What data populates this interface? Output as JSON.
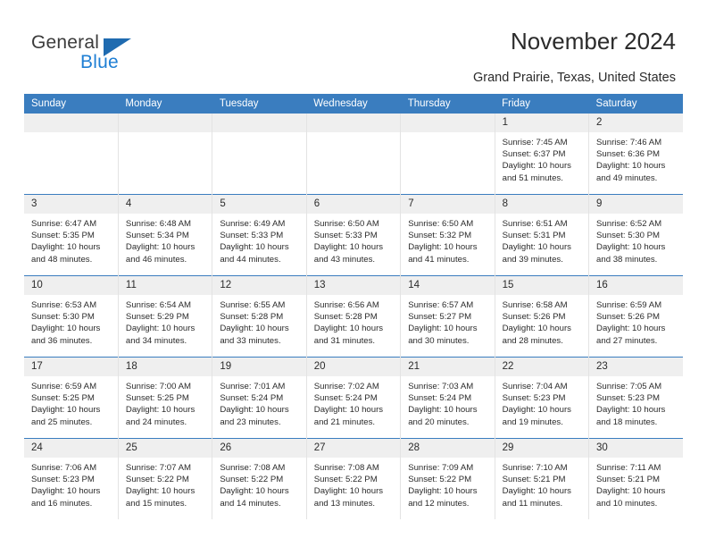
{
  "brand": {
    "name_top": "General",
    "name_bottom": "Blue",
    "triangle_color": "#1f6bb0",
    "blue_color": "#1f7fd4"
  },
  "header": {
    "title": "November 2024",
    "subtitle": "Grand Prairie, Texas, United States",
    "header_bg": "#3a7dbf",
    "daynum_bg": "#efefef"
  },
  "weekdays": [
    "Sunday",
    "Monday",
    "Tuesday",
    "Wednesday",
    "Thursday",
    "Friday",
    "Saturday"
  ],
  "labels": {
    "sunrise": "Sunrise:",
    "sunset": "Sunset:",
    "daylight": "Daylight:"
  },
  "weeks": [
    [
      {
        "day": "",
        "empty": true
      },
      {
        "day": "",
        "empty": true
      },
      {
        "day": "",
        "empty": true
      },
      {
        "day": "",
        "empty": true
      },
      {
        "day": "",
        "empty": true
      },
      {
        "day": "1",
        "sunrise": "Sunrise: 7:45 AM",
        "sunset": "Sunset: 6:37 PM",
        "daylight1": "Daylight: 10 hours",
        "daylight2": "and 51 minutes."
      },
      {
        "day": "2",
        "sunrise": "Sunrise: 7:46 AM",
        "sunset": "Sunset: 6:36 PM",
        "daylight1": "Daylight: 10 hours",
        "daylight2": "and 49 minutes."
      }
    ],
    [
      {
        "day": "3",
        "sunrise": "Sunrise: 6:47 AM",
        "sunset": "Sunset: 5:35 PM",
        "daylight1": "Daylight: 10 hours",
        "daylight2": "and 48 minutes."
      },
      {
        "day": "4",
        "sunrise": "Sunrise: 6:48 AM",
        "sunset": "Sunset: 5:34 PM",
        "daylight1": "Daylight: 10 hours",
        "daylight2": "and 46 minutes."
      },
      {
        "day": "5",
        "sunrise": "Sunrise: 6:49 AM",
        "sunset": "Sunset: 5:33 PM",
        "daylight1": "Daylight: 10 hours",
        "daylight2": "and 44 minutes."
      },
      {
        "day": "6",
        "sunrise": "Sunrise: 6:50 AM",
        "sunset": "Sunset: 5:33 PM",
        "daylight1": "Daylight: 10 hours",
        "daylight2": "and 43 minutes."
      },
      {
        "day": "7",
        "sunrise": "Sunrise: 6:50 AM",
        "sunset": "Sunset: 5:32 PM",
        "daylight1": "Daylight: 10 hours",
        "daylight2": "and 41 minutes."
      },
      {
        "day": "8",
        "sunrise": "Sunrise: 6:51 AM",
        "sunset": "Sunset: 5:31 PM",
        "daylight1": "Daylight: 10 hours",
        "daylight2": "and 39 minutes."
      },
      {
        "day": "9",
        "sunrise": "Sunrise: 6:52 AM",
        "sunset": "Sunset: 5:30 PM",
        "daylight1": "Daylight: 10 hours",
        "daylight2": "and 38 minutes."
      }
    ],
    [
      {
        "day": "10",
        "sunrise": "Sunrise: 6:53 AM",
        "sunset": "Sunset: 5:30 PM",
        "daylight1": "Daylight: 10 hours",
        "daylight2": "and 36 minutes."
      },
      {
        "day": "11",
        "sunrise": "Sunrise: 6:54 AM",
        "sunset": "Sunset: 5:29 PM",
        "daylight1": "Daylight: 10 hours",
        "daylight2": "and 34 minutes."
      },
      {
        "day": "12",
        "sunrise": "Sunrise: 6:55 AM",
        "sunset": "Sunset: 5:28 PM",
        "daylight1": "Daylight: 10 hours",
        "daylight2": "and 33 minutes."
      },
      {
        "day": "13",
        "sunrise": "Sunrise: 6:56 AM",
        "sunset": "Sunset: 5:28 PM",
        "daylight1": "Daylight: 10 hours",
        "daylight2": "and 31 minutes."
      },
      {
        "day": "14",
        "sunrise": "Sunrise: 6:57 AM",
        "sunset": "Sunset: 5:27 PM",
        "daylight1": "Daylight: 10 hours",
        "daylight2": "and 30 minutes."
      },
      {
        "day": "15",
        "sunrise": "Sunrise: 6:58 AM",
        "sunset": "Sunset: 5:26 PM",
        "daylight1": "Daylight: 10 hours",
        "daylight2": "and 28 minutes."
      },
      {
        "day": "16",
        "sunrise": "Sunrise: 6:59 AM",
        "sunset": "Sunset: 5:26 PM",
        "daylight1": "Daylight: 10 hours",
        "daylight2": "and 27 minutes."
      }
    ],
    [
      {
        "day": "17",
        "sunrise": "Sunrise: 6:59 AM",
        "sunset": "Sunset: 5:25 PM",
        "daylight1": "Daylight: 10 hours",
        "daylight2": "and 25 minutes."
      },
      {
        "day": "18",
        "sunrise": "Sunrise: 7:00 AM",
        "sunset": "Sunset: 5:25 PM",
        "daylight1": "Daylight: 10 hours",
        "daylight2": "and 24 minutes."
      },
      {
        "day": "19",
        "sunrise": "Sunrise: 7:01 AM",
        "sunset": "Sunset: 5:24 PM",
        "daylight1": "Daylight: 10 hours",
        "daylight2": "and 23 minutes."
      },
      {
        "day": "20",
        "sunrise": "Sunrise: 7:02 AM",
        "sunset": "Sunset: 5:24 PM",
        "daylight1": "Daylight: 10 hours",
        "daylight2": "and 21 minutes."
      },
      {
        "day": "21",
        "sunrise": "Sunrise: 7:03 AM",
        "sunset": "Sunset: 5:24 PM",
        "daylight1": "Daylight: 10 hours",
        "daylight2": "and 20 minutes."
      },
      {
        "day": "22",
        "sunrise": "Sunrise: 7:04 AM",
        "sunset": "Sunset: 5:23 PM",
        "daylight1": "Daylight: 10 hours",
        "daylight2": "and 19 minutes."
      },
      {
        "day": "23",
        "sunrise": "Sunrise: 7:05 AM",
        "sunset": "Sunset: 5:23 PM",
        "daylight1": "Daylight: 10 hours",
        "daylight2": "and 18 minutes."
      }
    ],
    [
      {
        "day": "24",
        "sunrise": "Sunrise: 7:06 AM",
        "sunset": "Sunset: 5:23 PM",
        "daylight1": "Daylight: 10 hours",
        "daylight2": "and 16 minutes."
      },
      {
        "day": "25",
        "sunrise": "Sunrise: 7:07 AM",
        "sunset": "Sunset: 5:22 PM",
        "daylight1": "Daylight: 10 hours",
        "daylight2": "and 15 minutes."
      },
      {
        "day": "26",
        "sunrise": "Sunrise: 7:08 AM",
        "sunset": "Sunset: 5:22 PM",
        "daylight1": "Daylight: 10 hours",
        "daylight2": "and 14 minutes."
      },
      {
        "day": "27",
        "sunrise": "Sunrise: 7:08 AM",
        "sunset": "Sunset: 5:22 PM",
        "daylight1": "Daylight: 10 hours",
        "daylight2": "and 13 minutes."
      },
      {
        "day": "28",
        "sunrise": "Sunrise: 7:09 AM",
        "sunset": "Sunset: 5:22 PM",
        "daylight1": "Daylight: 10 hours",
        "daylight2": "and 12 minutes."
      },
      {
        "day": "29",
        "sunrise": "Sunrise: 7:10 AM",
        "sunset": "Sunset: 5:21 PM",
        "daylight1": "Daylight: 10 hours",
        "daylight2": "and 11 minutes."
      },
      {
        "day": "30",
        "sunrise": "Sunrise: 7:11 AM",
        "sunset": "Sunset: 5:21 PM",
        "daylight1": "Daylight: 10 hours",
        "daylight2": "and 10 minutes."
      }
    ]
  ]
}
